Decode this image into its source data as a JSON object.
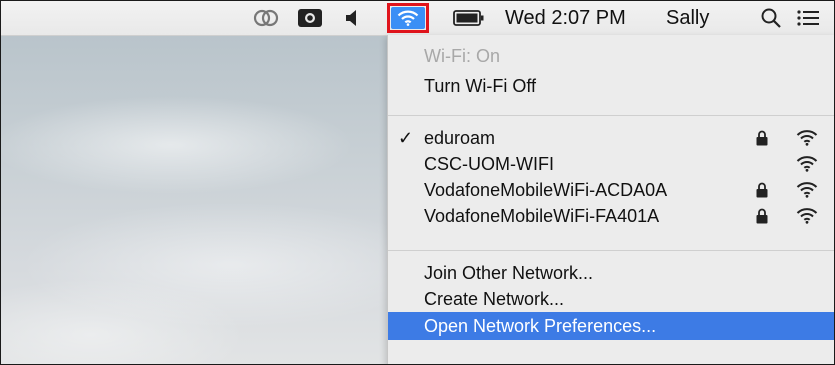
{
  "menubar": {
    "icons": [
      "creative-cloud-icon",
      "camera-icon",
      "volume-icon",
      "wifi-icon",
      "battery-icon",
      "search-icon",
      "list-icon"
    ],
    "clock": "Wed 2:07 PM",
    "user": "Sally"
  },
  "wifi_menu": {
    "status": "Wi-Fi: On",
    "toggle": "Turn Wi-Fi Off",
    "networks": [
      {
        "name": "eduroam",
        "connected": true,
        "locked": true,
        "signal_icon": "wifi-signal-icon"
      },
      {
        "name": "CSC-UOM-WIFI",
        "connected": false,
        "locked": false,
        "signal_icon": "wifi-signal-icon"
      },
      {
        "name": "VodafoneMobileWiFi-ACDA0A",
        "connected": false,
        "locked": true,
        "signal_icon": "wifi-signal-icon"
      },
      {
        "name": "VodafoneMobileWiFi-FA401A",
        "connected": false,
        "locked": true,
        "signal_icon": "wifi-signal-icon"
      }
    ],
    "connected_mark": "✓",
    "actions": {
      "join_other": "Join Other Network...",
      "create": "Create Network...",
      "open_prefs": "Open Network Preferences..."
    },
    "highlighted": "open_prefs"
  },
  "colors": {
    "highlight": "#3d7be5",
    "wifi_active_bg": "#3b8ff5",
    "annotation_border": "#e0141c"
  }
}
